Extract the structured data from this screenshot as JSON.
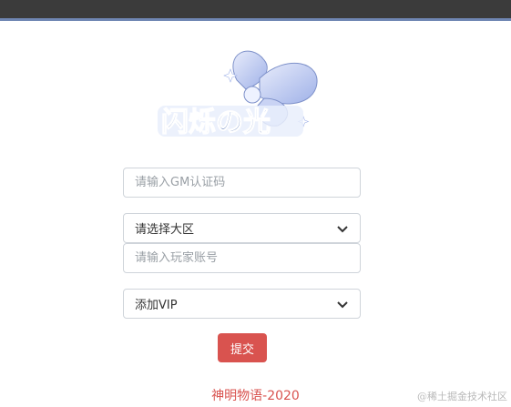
{
  "logo": {
    "text": "闪烁の光",
    "colors": {
      "primary": "#2b56a6",
      "accent": "#a7b6e6",
      "wings": "#b8c6f2"
    }
  },
  "form": {
    "gm_code_placeholder": "请输入GM认证码",
    "region_select_value": "请选择大区",
    "account_placeholder": "请输入玩家账号",
    "vip_select_value": "添加VIP",
    "submit_label": "提交"
  },
  "footer": {
    "text": "神明物语-2020"
  },
  "watermark": {
    "text": "@稀土掘金技术社区"
  },
  "colors": {
    "submit_bg": "#d9534f",
    "topbar": "#3b3b3b",
    "accent_line": "#6f86b3"
  }
}
